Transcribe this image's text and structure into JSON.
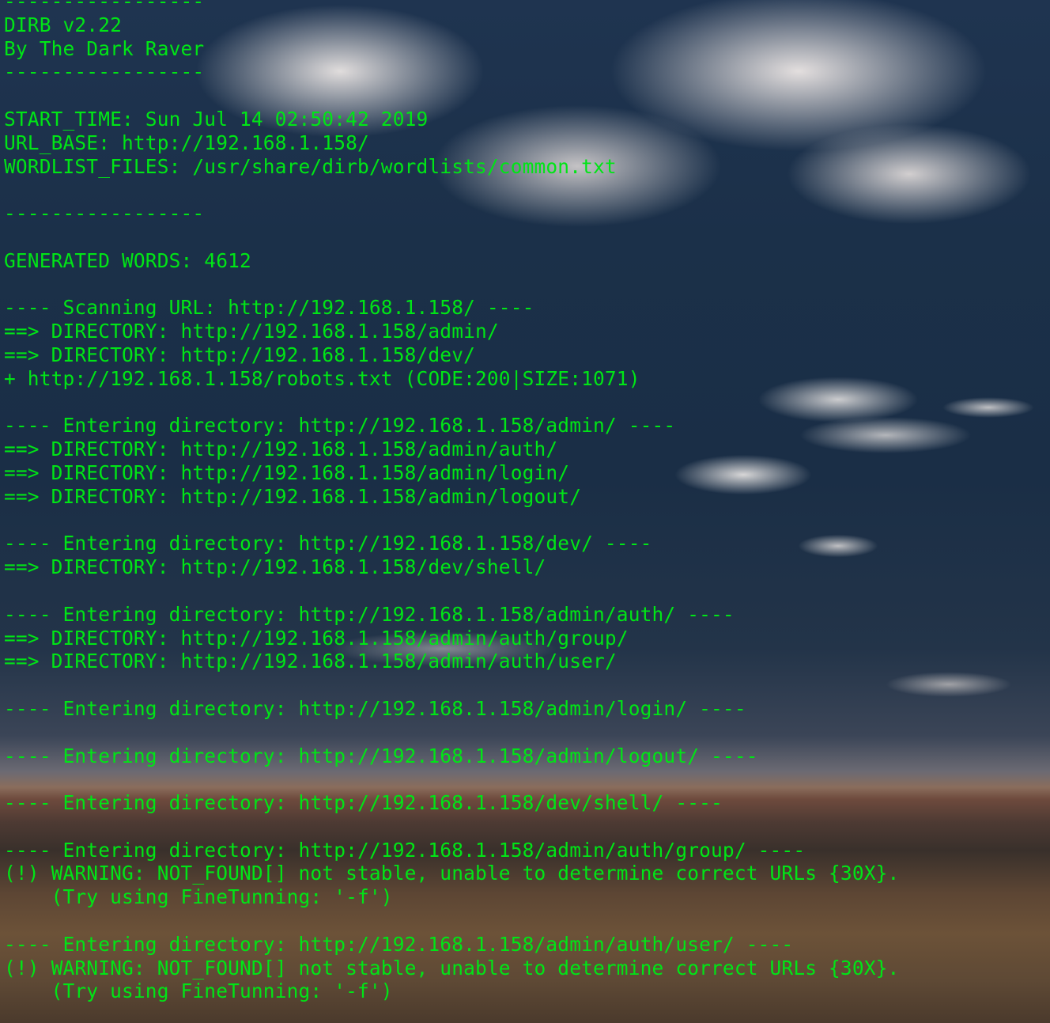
{
  "terminal": {
    "text_color": "#00e516",
    "lines": [
      "-----------------",
      "DIRB v2.22",
      "By The Dark Raver",
      "-----------------",
      "",
      "START_TIME: Sun Jul 14 02:50:42 2019",
      "URL_BASE: http://192.168.1.158/",
      "WORDLIST_FILES: /usr/share/dirb/wordlists/common.txt",
      "",
      "-----------------",
      "",
      "GENERATED WORDS: 4612",
      "",
      "---- Scanning URL: http://192.168.1.158/ ----",
      "==> DIRECTORY: http://192.168.1.158/admin/",
      "==> DIRECTORY: http://192.168.1.158/dev/",
      "+ http://192.168.1.158/robots.txt (CODE:200|SIZE:1071)",
      "",
      "---- Entering directory: http://192.168.1.158/admin/ ----",
      "==> DIRECTORY: http://192.168.1.158/admin/auth/",
      "==> DIRECTORY: http://192.168.1.158/admin/login/",
      "==> DIRECTORY: http://192.168.1.158/admin/logout/",
      "",
      "---- Entering directory: http://192.168.1.158/dev/ ----",
      "==> DIRECTORY: http://192.168.1.158/dev/shell/",
      "",
      "---- Entering directory: http://192.168.1.158/admin/auth/ ----",
      "==> DIRECTORY: http://192.168.1.158/admin/auth/group/",
      "==> DIRECTORY: http://192.168.1.158/admin/auth/user/",
      "",
      "---- Entering directory: http://192.168.1.158/admin/login/ ----",
      "",
      "---- Entering directory: http://192.168.1.158/admin/logout/ ----",
      "",
      "---- Entering directory: http://192.168.1.158/dev/shell/ ----",
      "",
      "---- Entering directory: http://192.168.1.158/admin/auth/group/ ----",
      "(!) WARNING: NOT_FOUND[] not stable, unable to determine correct URLs {30X}.",
      "    (Try using FineTunning: '-f')",
      "",
      "---- Entering directory: http://192.168.1.158/admin/auth/user/ ----",
      "(!) WARNING: NOT_FOUND[] not stable, unable to determine correct URLs {30X}.",
      "    (Try using FineTunning: '-f')"
    ]
  }
}
